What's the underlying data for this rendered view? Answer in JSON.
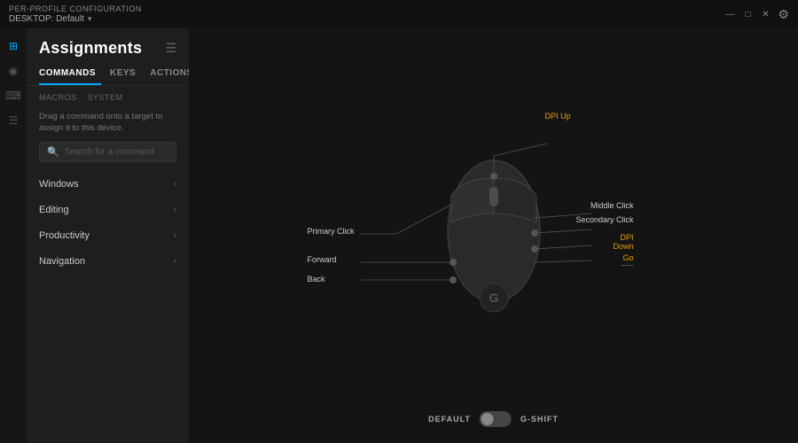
{
  "titlebar": {
    "subtitle": "PER-PROFILE CONFIGURATION",
    "profile": "DESKTOP: Default",
    "controls": [
      "—",
      "□",
      "✕"
    ]
  },
  "sidebar": {
    "title": "Assignments",
    "header_icon": "≡",
    "tabs": [
      {
        "label": "COMMANDS",
        "active": true
      },
      {
        "label": "KEYS",
        "active": false
      },
      {
        "label": "ACTIONS",
        "active": false
      }
    ],
    "sub_tabs": [
      {
        "label": "MACROS"
      },
      {
        "label": "SYSTEM"
      }
    ],
    "instruction": "Drag a command onto a target to assign it to this device.",
    "search_placeholder": "Search for a command",
    "categories": [
      {
        "label": "Windows"
      },
      {
        "label": "Editing"
      },
      {
        "label": "Productivity"
      },
      {
        "label": "Navigation"
      }
    ]
  },
  "mouse_diagram": {
    "labels": {
      "dpi_up": "DPI Up",
      "middle_click": "Middle Click",
      "secondary_click": "Secondary Click",
      "dpi_down": "DPI",
      "dpi_down2": "Down",
      "go": "Go",
      "primary_click": "Primary Click",
      "forward": "Forward",
      "back": "Back",
      "dots": "——"
    }
  },
  "bottom_toggle": {
    "left_label": "DEFAULT",
    "right_label": "G-SHIFT"
  },
  "icons": {
    "back": "←",
    "search": "🔍",
    "chevron": "›",
    "gear": "⚙",
    "grid": "⊞",
    "list": "☰",
    "keyboard": "⌨",
    "mouse": "◉"
  }
}
